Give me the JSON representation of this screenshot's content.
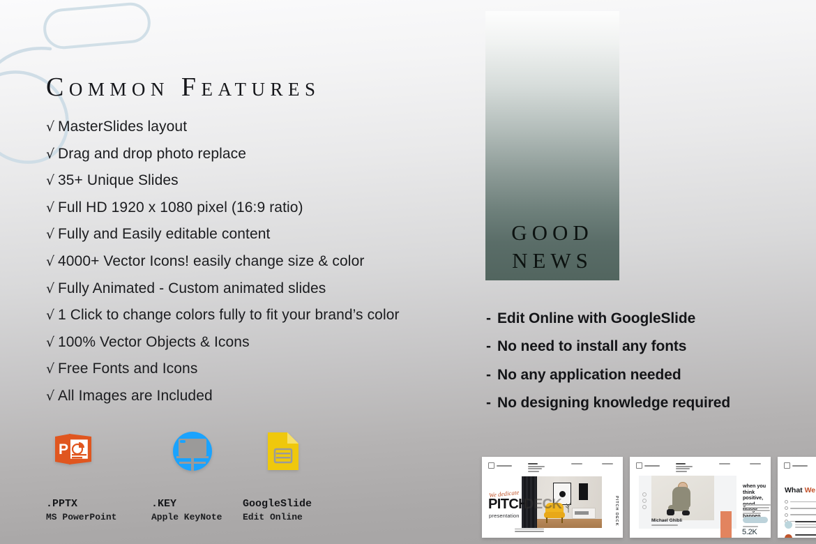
{
  "title": "Common Features",
  "features": [
    {
      "check": "√",
      "label": "MasterSlides layout"
    },
    {
      "check": "√",
      "label": "Drag and drop photo replace"
    },
    {
      "check": "√",
      "label": "35+ Unique Slides"
    },
    {
      "check": "√",
      "label": "Full HD 1920 x 1080 pixel (16:9 ratio)"
    },
    {
      "check": "√",
      "label": "Fully and Easily editable content"
    },
    {
      "check": "√",
      "label": "4000+ Vector Icons! easily change size & color"
    },
    {
      "check": "√",
      "label": "Fully Animated - Custom animated slides"
    },
    {
      "check": "√",
      "label": "1 Click to change colors fully to fit your brand’s color"
    },
    {
      "check": "√",
      "label": "100% Vector Objects & Icons"
    },
    {
      "check": "√",
      "label": "Free Fonts and Icons"
    },
    {
      "check": "√",
      "label": "All Images are Included"
    }
  ],
  "formats": [
    {
      "icon": "powerpoint-icon",
      "name": ".PPTX",
      "sub": "MS PowerPoint",
      "color": "#E0561F"
    },
    {
      "icon": "keynote-icon",
      "name": ".KEY",
      "sub": "Apple KeyNote",
      "color": "#1AA3FF"
    },
    {
      "icon": "googleslides-icon",
      "name": "GoogleSlide",
      "sub": "Edit Online",
      "color": "#EFC80C"
    }
  ],
  "news_panel": {
    "line1": "GOOD",
    "line2": "NEWS",
    "gradient_top": "#fdfdfd",
    "gradient_bottom": "#52655f"
  },
  "benefits": [
    {
      "dash": "-",
      "label": "Edit Online with GoogleSlide"
    },
    {
      "dash": "-",
      "label": "No need to install any fonts"
    },
    {
      "dash": "-",
      "label": "No any application needed"
    },
    {
      "dash": "-",
      "label": "No designing knowledge required"
    }
  ],
  "thumbnails": [
    {
      "name": "pitch-deck-slide",
      "script": "We dedicate",
      "headline": "PITCH",
      "headline_ghost": "DECK",
      "subtitle": "presentation",
      "vertical": "PITCH DECK"
    },
    {
      "name": "positive-thinking-slide",
      "quote": "when you think positive, good things happen",
      "person": "Michael Ghibli",
      "stat": "5.2K",
      "accent": "#e2845f"
    },
    {
      "name": "what-we-offer-slide",
      "head_a": "What ",
      "head_b": "We Offer?"
    }
  ],
  "doodles": {
    "color": "#cfdde6"
  }
}
